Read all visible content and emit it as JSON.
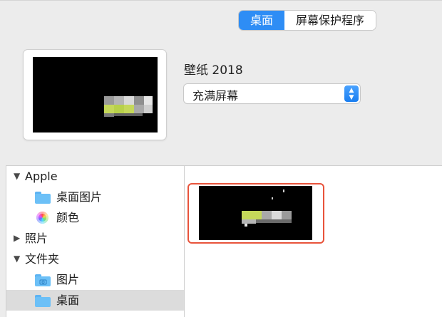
{
  "tabs": [
    {
      "label": "桌面",
      "active": true
    },
    {
      "label": "屏幕保护程序",
      "active": false
    }
  ],
  "preview": {
    "name": "壁纸 2018",
    "fit_option": "充满屏幕"
  },
  "sidebar": {
    "groups": [
      {
        "label": "Apple",
        "disclosure": "▼",
        "items": [
          {
            "label": "桌面图片",
            "icon": "folder-icon"
          },
          {
            "label": "颜色",
            "icon": "color-wheel-icon"
          }
        ]
      },
      {
        "label": "照片",
        "disclosure": "▶",
        "items": []
      },
      {
        "label": "文件夹",
        "disclosure": "▼",
        "items": [
          {
            "label": "图片",
            "icon": "pictures-folder-icon"
          },
          {
            "label": "桌面",
            "icon": "folder-icon",
            "selected": true
          }
        ]
      }
    ]
  },
  "colors": {
    "accent": "#2e8df5",
    "selection_border": "#e8533b",
    "wallpaper_green": "#c5d85a"
  }
}
